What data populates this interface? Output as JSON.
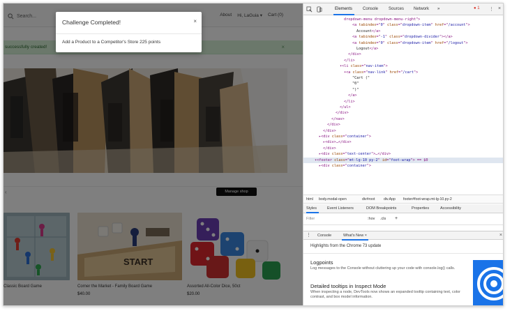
{
  "site": {
    "search_placeholder": "Search...",
    "nav": [
      "About",
      "Hi, LaGuia ▾",
      "Cart (0)"
    ],
    "alert_text": "successfully created!",
    "alert_close": "×",
    "manage_shop_label": "Manage shop",
    "section_mark": "‹",
    "products": [
      {
        "name": "Classic Board Game",
        "price": ""
      },
      {
        "name": "Corner the Market - Family Board Game",
        "price": "$40.00"
      },
      {
        "name": "Assorted All-Color Dice, 50ct",
        "price": "$20.00"
      }
    ],
    "start_text": "START"
  },
  "modal": {
    "title": "Challenge Completed!",
    "close": "×",
    "body": "Add a Product to a Competitor's Store 225 points"
  },
  "devtools": {
    "tabs": [
      "Elements",
      "Console",
      "Sources",
      "Network",
      "»"
    ],
    "error_count": "1",
    "more_icon": "⋮",
    "close_icon": "×",
    "code_lines": [
      {
        "indent": 9,
        "parts": [
          [
            "tag",
            "dropdown-menu dropdown-menu-right\">"
          ]
        ]
      },
      {
        "indent": 11,
        "parts": [
          [
            "tag",
            "<a "
          ],
          [
            "attr",
            "tabindex"
          ],
          [
            "tag",
            "=\""
          ],
          [
            "val",
            "0"
          ],
          [
            "tag",
            "\" "
          ],
          [
            "attr",
            "class"
          ],
          [
            "tag",
            "=\""
          ],
          [
            "val",
            "dropdown-item"
          ],
          [
            "tag",
            "\" "
          ],
          [
            "attr",
            "href"
          ],
          [
            "tag",
            "=\""
          ],
          [
            "val",
            "/account"
          ],
          [
            "tag",
            "\">"
          ]
        ]
      },
      {
        "indent": 12,
        "parts": [
          [
            "txt",
            "Account"
          ],
          [
            "tag",
            "</a>"
          ]
        ]
      },
      {
        "indent": 11,
        "parts": [
          [
            "tag",
            "<a "
          ],
          [
            "attr",
            "tabindex"
          ],
          [
            "tag",
            "=\""
          ],
          [
            "val",
            "-1"
          ],
          [
            "tag",
            "\" "
          ],
          [
            "attr",
            "class"
          ],
          [
            "tag",
            "=\""
          ],
          [
            "val",
            "dropdown-divider"
          ],
          [
            "tag",
            "\"></a>"
          ]
        ]
      },
      {
        "indent": 11,
        "parts": [
          [
            "tag",
            "<a "
          ],
          [
            "attr",
            "tabindex"
          ],
          [
            "tag",
            "=\""
          ],
          [
            "val",
            "0"
          ],
          [
            "tag",
            "\" "
          ],
          [
            "attr",
            "class"
          ],
          [
            "tag",
            "=\""
          ],
          [
            "val",
            "dropdown-item"
          ],
          [
            "tag",
            "\" "
          ],
          [
            "attr",
            "href"
          ],
          [
            "tag",
            "=\""
          ],
          [
            "val",
            "/logout"
          ],
          [
            "tag",
            "\">"
          ]
        ]
      },
      {
        "indent": 12,
        "parts": [
          [
            "txt",
            "Logout"
          ],
          [
            "tag",
            "</a>"
          ]
        ]
      },
      {
        "indent": 10,
        "parts": [
          [
            "tag",
            "</div>"
          ]
        ]
      },
      {
        "indent": 9,
        "parts": [
          [
            "tag",
            "</li>"
          ]
        ]
      },
      {
        "indent": 8,
        "parts": [
          [
            "tag",
            "▾<li "
          ],
          [
            "attr",
            "class"
          ],
          [
            "tag",
            "=\""
          ],
          [
            "val",
            "nav-item"
          ],
          [
            "tag",
            "\">"
          ]
        ]
      },
      {
        "indent": 9,
        "parts": [
          [
            "tag",
            "▾<a "
          ],
          [
            "attr",
            "class"
          ],
          [
            "tag",
            "=\""
          ],
          [
            "val",
            "nav-link"
          ],
          [
            "tag",
            "\" "
          ],
          [
            "attr",
            "href"
          ],
          [
            "tag",
            "=\""
          ],
          [
            "val",
            "/cart"
          ],
          [
            "tag",
            "\">"
          ]
        ]
      },
      {
        "indent": 11,
        "parts": [
          [
            "txt",
            "\"Cart (\""
          ]
        ]
      },
      {
        "indent": 11,
        "parts": [
          [
            "txt",
            "\"0\""
          ]
        ]
      },
      {
        "indent": 11,
        "parts": [
          [
            "txt",
            "\")\""
          ]
        ]
      },
      {
        "indent": 10,
        "parts": [
          [
            "tag",
            "</a>"
          ]
        ]
      },
      {
        "indent": 9,
        "parts": [
          [
            "tag",
            "</li>"
          ]
        ]
      },
      {
        "indent": 8,
        "parts": [
          [
            "tag",
            "</ul>"
          ]
        ]
      },
      {
        "indent": 7,
        "parts": [
          [
            "tag",
            "</div>"
          ]
        ]
      },
      {
        "indent": 6,
        "parts": [
          [
            "tag",
            "</nav>"
          ]
        ]
      },
      {
        "indent": 5,
        "parts": [
          [
            "tag",
            "</div>"
          ]
        ]
      },
      {
        "indent": 4,
        "parts": [
          [
            "tag",
            "</div>"
          ]
        ]
      },
      {
        "indent": 3,
        "parts": [
          [
            "tag",
            "▸<div "
          ],
          [
            "attr",
            "class"
          ],
          [
            "tag",
            "=\""
          ],
          [
            "val",
            "container"
          ],
          [
            "tag",
            "\">"
          ]
        ]
      },
      {
        "indent": 4,
        "parts": [
          [
            "tag",
            "▸<div>…</div>"
          ]
        ]
      },
      {
        "indent": 4,
        "parts": [
          [
            "tag",
            "</div>"
          ]
        ]
      },
      {
        "indent": 3,
        "parts": [
          [
            "tag",
            "▸<div "
          ],
          [
            "attr",
            "class"
          ],
          [
            "tag",
            "=\""
          ],
          [
            "val",
            "text-center"
          ],
          [
            "tag",
            "\">…</div>"
          ]
        ]
      },
      {
        "indent": 2,
        "selected": true,
        "parts": [
          [
            "tag",
            "▾<footer "
          ],
          [
            "attr",
            "class"
          ],
          [
            "tag",
            "=\""
          ],
          [
            "val",
            "mt-lg-10 py-2"
          ],
          [
            "tag",
            "\" "
          ],
          [
            "attr",
            "id"
          ],
          [
            "tag",
            "=\""
          ],
          [
            "val",
            "foot-wrap"
          ],
          [
            "tag",
            "\"> == $0"
          ]
        ]
      },
      {
        "indent": 3,
        "parts": [
          [
            "tag",
            "▸<div "
          ],
          [
            "attr",
            "class"
          ],
          [
            "tag",
            "=\""
          ],
          [
            "val",
            "container"
          ],
          [
            "tag",
            "\">"
          ]
        ]
      }
    ],
    "breadcrumbs": [
      "html",
      "body.modal-open",
      "div#root",
      "div.App",
      "footer#foot-wrap.mt-lg-10.py-2"
    ],
    "subtabs": [
      "Styles",
      "Event Listeners",
      "DOM Breakpoints",
      "Properties",
      "Accessibility"
    ],
    "filter_placeholder": "Filter",
    "filter_hov": ":hov",
    "filter_cls": ".cls",
    "filter_plus": "+",
    "drawer_tabs": [
      "Console",
      "What's New ×"
    ],
    "whats_new_heading": "Highlights from the Chrome 73 update",
    "items": [
      {
        "title": "Logpoints",
        "desc": "Log messages to the Console without cluttering up your code with console.log() calls."
      },
      {
        "title": "Detailed tooltips in Inspect Mode",
        "desc": "When inspecting a node, DevTools now shows an expanded tooltip containing text, color contrast, and box model information."
      }
    ]
  }
}
